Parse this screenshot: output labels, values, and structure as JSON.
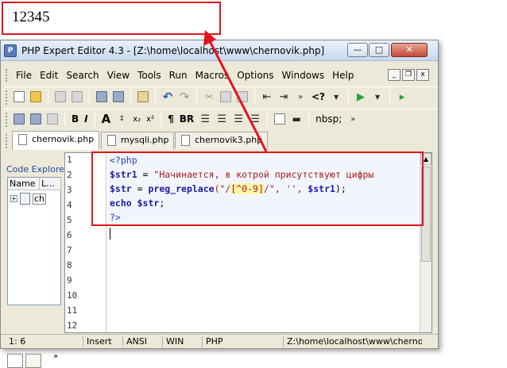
{
  "output": {
    "text": "12345"
  },
  "window": {
    "title": "PHP Expert Editor 4.3 - [Z:\\home\\localhost\\www\\chernovik.php]",
    "app_icon": "php-icon",
    "controls": {
      "minimize": "—",
      "maximize": "□",
      "close": "✕"
    }
  },
  "menu": {
    "items": [
      "File",
      "Edit",
      "Search",
      "View",
      "Tools",
      "Run",
      "Macros",
      "Options",
      "Windows",
      "Help"
    ],
    "mdi": {
      "minimize": "_",
      "restore": "❐",
      "close": "x"
    }
  },
  "toolbar1": {
    "php_tag_label": "<?",
    "overflow": "»"
  },
  "toolbar2": {
    "bold": "B",
    "italic": "I",
    "font_grow": "A",
    "sub": "x₂",
    "sup": "x²",
    "para": "¶",
    "br": "BR",
    "nbsp": "nbsp;",
    "overflow": "»"
  },
  "tabs": [
    {
      "label": "chernovik.php",
      "active": true
    },
    {
      "label": "mysqli.php",
      "active": false
    },
    {
      "label": "chernovik3.php",
      "active": false
    }
  ],
  "explorer": {
    "title": "Code Explorer",
    "columns": [
      "Name",
      "L..."
    ],
    "tree_item": "ch",
    "more": "»"
  },
  "editor": {
    "line_numbers": [
      "1",
      "2",
      "3",
      "4",
      "5",
      "6",
      "7",
      "8",
      "9",
      "10",
      "11",
      "12"
    ],
    "code": {
      "l1": "<?php",
      "l2_var": "$str1",
      "l2_op": " = ",
      "l2_str": "\"Начинается, в котрой присутствуют цифры",
      "l3_var": "$str",
      "l3_op": " = ",
      "l3_func": "preg_replace",
      "l3_p1": "(\"/",
      "l3_regex": "[^0-9]",
      "l3_p2": "/\", '', ",
      "l3_var2": "$str1",
      "l3_end": ");",
      "l4_kw": "echo",
      "l4_var": " $str",
      "l4_end": ";",
      "l5": "?>"
    }
  },
  "status": {
    "position": "1: 6",
    "mode": "Insert",
    "encoding": "ANSI",
    "eol": "WIN",
    "language": "PHP",
    "path": "Z:\\home\\localhost\\www\\chernovik.php"
  },
  "colors": {
    "highlight_red": "#e0141e",
    "php_keyword": "#1a1aa8",
    "php_string": "#a61b1b",
    "regex_bg": "#fff7a8"
  }
}
